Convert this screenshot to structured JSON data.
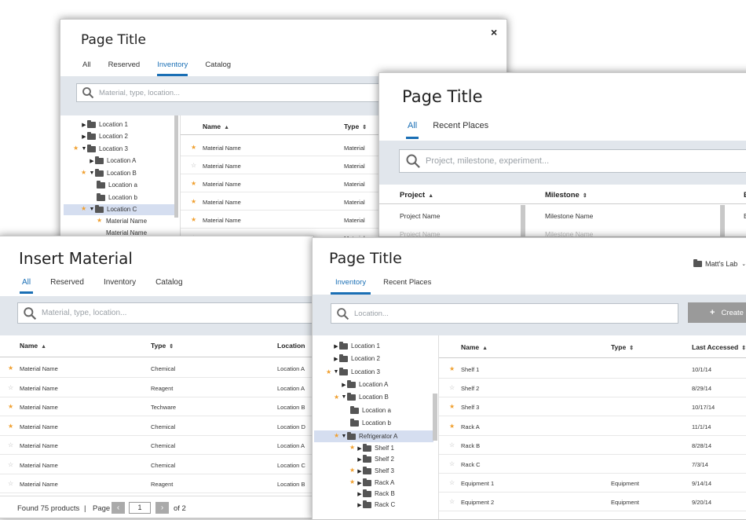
{
  "win1": {
    "title": "Page Title",
    "close": "×",
    "tabs": [
      "All",
      "Reserved",
      "Inventory",
      "Catalog"
    ],
    "search_placeholder": "Material, type, location...",
    "tree": [
      "Location 1",
      "Location 2",
      "Location 3",
      "Location A",
      "Location B",
      "Location a",
      "Location b",
      "Location C",
      "Material Name",
      "Material Name"
    ],
    "columns": {
      "name": "Name",
      "type": "Type"
    },
    "rows": [
      {
        "name": "Material Name",
        "type": "Material",
        "starred": true
      },
      {
        "name": "Material Name",
        "type": "Material",
        "starred": false
      },
      {
        "name": "Material Name",
        "type": "Material",
        "starred": true
      },
      {
        "name": "Material Name",
        "type": "Material",
        "starred": true
      },
      {
        "name": "Material Name",
        "type": "Material",
        "starred": true
      },
      {
        "name": "Material Name",
        "type": "Material",
        "starred": false
      }
    ]
  },
  "win2": {
    "title": "Page Title",
    "tabs": [
      "All",
      "Recent Places"
    ],
    "search_placeholder": "Project, milestone, experiment...",
    "columns": {
      "project": "Project",
      "milestone": "Milestone",
      "third": "E"
    },
    "rows": [
      {
        "project": "Project Name",
        "milestone": "Milestone Name",
        "third": "E"
      },
      {
        "project": "Project Name",
        "milestone": "Milestone Name",
        "third": ""
      }
    ]
  },
  "win3": {
    "title": "Insert Material",
    "tabs": [
      "All",
      "Reserved",
      "Inventory",
      "Catalog"
    ],
    "search_placeholder": "Material, type, location...",
    "columns": {
      "name": "Name",
      "type": "Type",
      "location": "Location"
    },
    "rows": [
      {
        "name": "Material Name",
        "type": "Chemical",
        "location": "Location A",
        "starred": true
      },
      {
        "name": "Material Name",
        "type": "Reagent",
        "location": "Location A",
        "starred": false
      },
      {
        "name": "Material Name",
        "type": "Techware",
        "location": "Location B",
        "starred": true
      },
      {
        "name": "Material Name",
        "type": "Chemical",
        "location": "Location D",
        "starred": true
      },
      {
        "name": "Material Name",
        "type": "Chemical",
        "location": "Location A",
        "starred": false
      },
      {
        "name": "Material Name",
        "type": "Chemical",
        "location": "Location C",
        "starred": false
      },
      {
        "name": "Material Name",
        "type": "Reagent",
        "location": "Location B",
        "starred": false
      }
    ],
    "footer": {
      "found": "Found 75 products",
      "sep": "|",
      "page_label": "Page",
      "prev": "‹",
      "page": "1",
      "next": "›",
      "of": "of 2"
    }
  },
  "win4": {
    "title": "Page Title",
    "tabs": [
      "Inventory",
      "Recent Places"
    ],
    "lab": "Matt's Lab",
    "search_placeholder": "Location...",
    "create": "Create",
    "tree": [
      "Location 1",
      "Location 2",
      "Location 3",
      "Location A",
      "Location B",
      "Location a",
      "Location b",
      "Refrigerator A",
      "Shelf 1",
      "Shelf 2",
      "Shelf 3",
      "Rack A",
      "Rack B",
      "Rack C"
    ],
    "columns": {
      "name": "Name",
      "type": "Type",
      "last": "Last Accessed"
    },
    "rows": [
      {
        "name": "Shelf 1",
        "type": "",
        "last": "10/1/14",
        "starred": true
      },
      {
        "name": "Shelf 2",
        "type": "",
        "last": "8/29/14",
        "starred": false
      },
      {
        "name": "Shelf 3",
        "type": "",
        "last": "10/17/14",
        "starred": true
      },
      {
        "name": "Rack A",
        "type": "",
        "last": "11/1/14",
        "starred": true
      },
      {
        "name": "Rack B",
        "type": "",
        "last": "8/28/14",
        "starred": false
      },
      {
        "name": "Rack C",
        "type": "",
        "last": "7/3/14",
        "starred": false
      },
      {
        "name": "Equipment 1",
        "type": "Equipment",
        "last": "9/14/14",
        "starred": false
      },
      {
        "name": "Equipment 2",
        "type": "Equipment",
        "last": "9/20/14",
        "starred": false
      }
    ]
  }
}
